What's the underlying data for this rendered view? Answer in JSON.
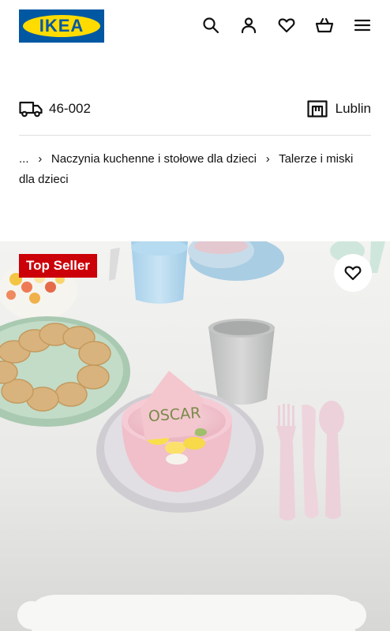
{
  "header": {
    "logo_text": "IKEA",
    "icons": [
      "search-icon",
      "account-icon",
      "heart-icon",
      "basket-icon",
      "menu-icon"
    ]
  },
  "location": {
    "postal_code": "46-002",
    "store": "Lublin"
  },
  "breadcrumb": {
    "ellipsis": "...",
    "items": [
      "Naczynia kuchenne i stołowe dla dzieci",
      "Talerze i miski dla dzieci"
    ]
  },
  "product": {
    "badge": "Top Seller",
    "card_text": "OSCAR"
  },
  "colors": {
    "ikea_blue": "#0058a3",
    "ikea_yellow": "#ffdb00",
    "badge_red": "#cc0008"
  }
}
